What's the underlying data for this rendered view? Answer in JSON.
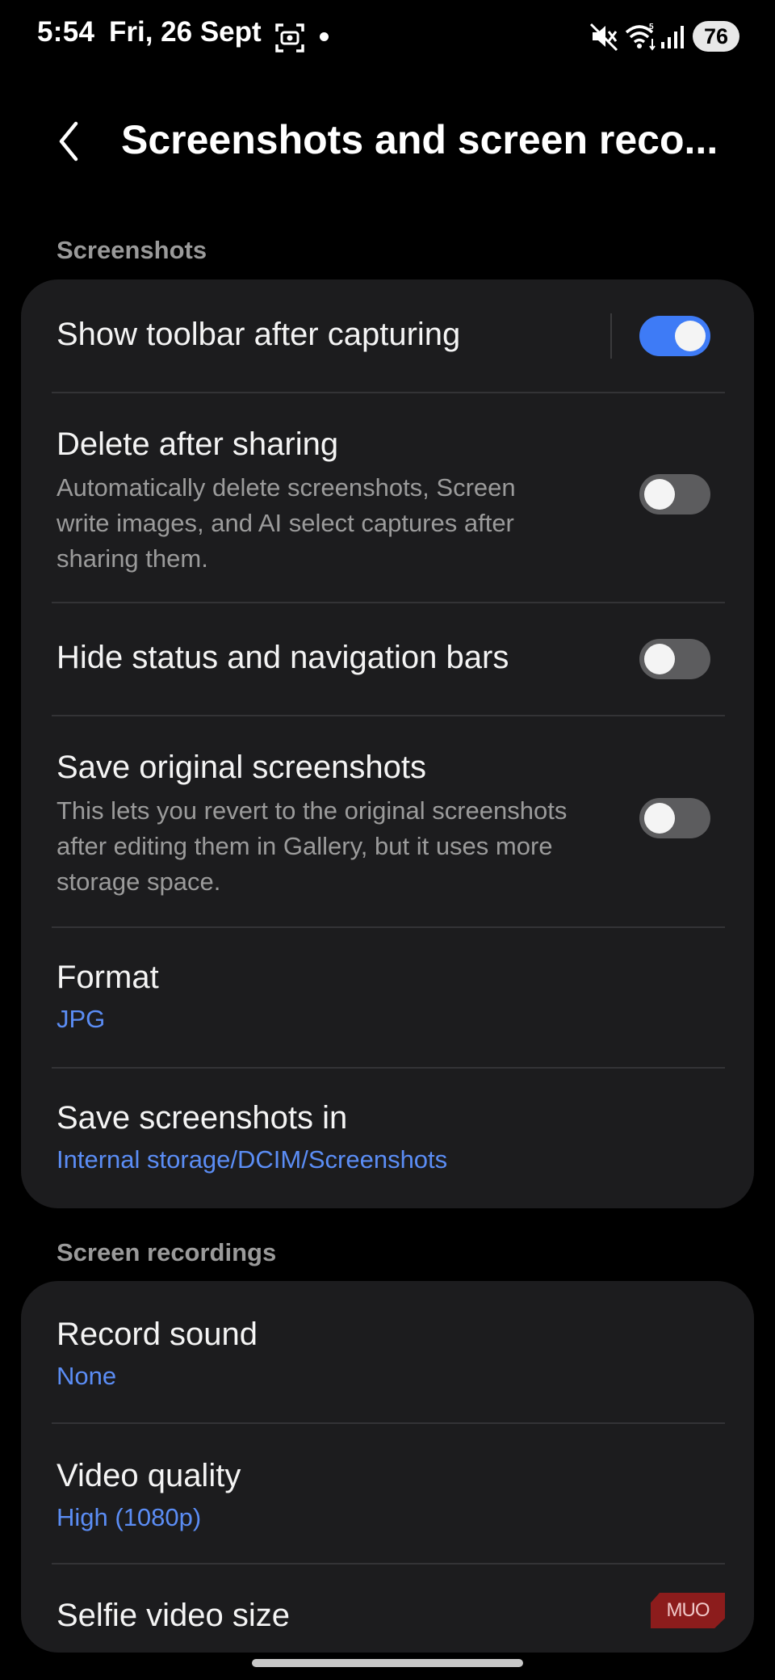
{
  "status_bar": {
    "time": "5:54",
    "date": "Fri, 26 Sept",
    "battery": "76",
    "icons": [
      "screenshot-icon",
      "notification-dot",
      "mute-icon",
      "wifi-icon",
      "signal-icon"
    ]
  },
  "header": {
    "title": "Screenshots and screen reco..."
  },
  "screenshots_section": {
    "header": "Screenshots",
    "items": [
      {
        "title": "Show toolbar after capturing",
        "toggle": true
      },
      {
        "title": "Delete after sharing",
        "desc_lines": [
          "Automatically delete screenshots, Screen",
          "write images, and AI select captures after",
          "sharing them."
        ],
        "toggle": false
      },
      {
        "title": "Hide status and navigation bars",
        "toggle": false
      },
      {
        "title": "Save original screenshots",
        "desc_lines": [
          "This lets you revert to the original screenshots",
          "after editing them in Gallery, but it uses more",
          "storage space."
        ],
        "toggle": false
      },
      {
        "title": "Format",
        "value": "JPG"
      },
      {
        "title": "Save screenshots in",
        "value": "Internal storage/DCIM/Screenshots"
      }
    ]
  },
  "recordings_section": {
    "header": "Screen recordings",
    "items": [
      {
        "title": "Record sound",
        "value": "None"
      },
      {
        "title": "Video quality",
        "value": "High (1080p)"
      },
      {
        "title": "Selfie video size"
      }
    ]
  },
  "watermark": "MUO",
  "colors": {
    "background": "#000000",
    "card": "#1c1c1e",
    "accent": "#3e7bf6",
    "link_value": "#5b8df5",
    "secondary_text": "#9b9b9b"
  }
}
